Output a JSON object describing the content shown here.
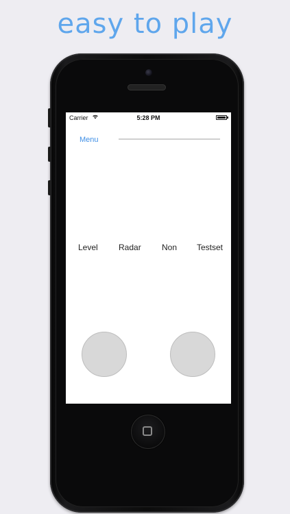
{
  "headline": "easy to play",
  "status_bar": {
    "carrier": "Carrier",
    "wifi_icon": "wifi-icon",
    "time": "5:28 PM",
    "battery_icon": "battery-icon"
  },
  "toolbar": {
    "menu_label": "Menu",
    "slider_value": 0.0
  },
  "modes": [
    {
      "label": "Level"
    },
    {
      "label": "Radar"
    },
    {
      "label": "Non"
    },
    {
      "label": "Testset"
    }
  ],
  "controls": {
    "left_pad": "left-pad",
    "right_pad": "right-pad"
  },
  "colors": {
    "background": "#eeedf2",
    "headline": "#5fa6ec",
    "accent": "#3f8fe6",
    "pad_fill": "#d8d8d8"
  }
}
